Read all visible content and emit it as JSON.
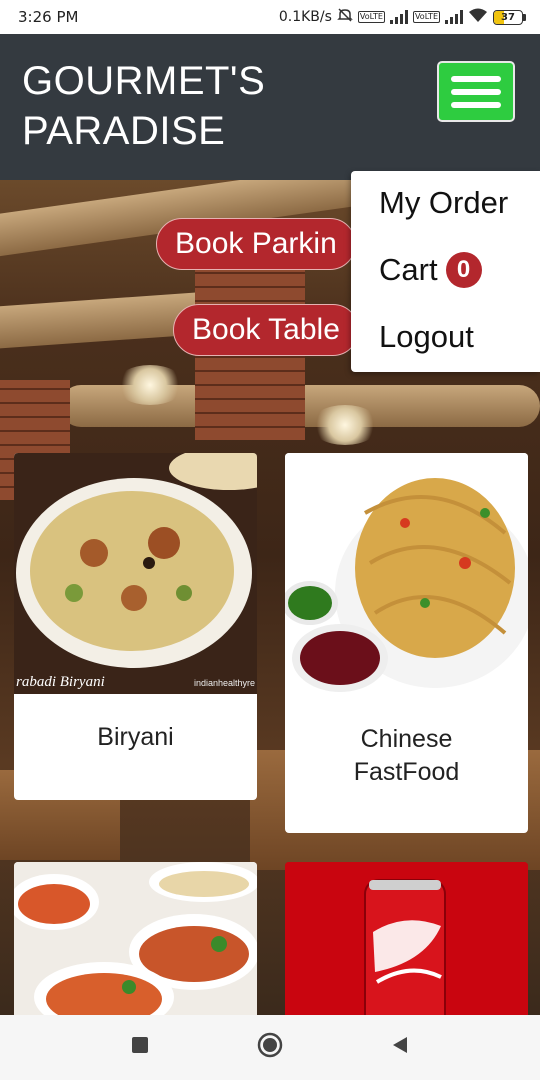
{
  "status_bar": {
    "time": "3:26 PM",
    "speed": "0.1KB/s",
    "sim1": "VoLTE",
    "sim2": "VoLTE",
    "battery": "37",
    "battery_level_pct": 37,
    "battery_color": "#f1c40f"
  },
  "header": {
    "brand_line1": "GOURMET'S",
    "brand_line2": "PARADISE",
    "menu_icon": "hamburger-menu-icon",
    "menu_color": "#2ecc40"
  },
  "actions": {
    "book_parking": "Book Parkin",
    "book_table": "Book Table"
  },
  "dropdown": {
    "my_order": "My Order",
    "cart": "Cart",
    "cart_count": "0",
    "logout": "Logout"
  },
  "categories": [
    {
      "label": "Biryani",
      "image_caption": "rabadi Biryani",
      "image_credit": "indianhealthyre"
    },
    {
      "label": "Chinese FastFood"
    },
    {
      "label": ""
    },
    {
      "label": ""
    }
  ],
  "colors": {
    "header_bg": "#343a40",
    "accent_red": "#b3272d"
  },
  "nav": {
    "recents_icon": "square-recents-icon",
    "home_icon": "circle-home-icon",
    "back_icon": "triangle-back-icon"
  }
}
